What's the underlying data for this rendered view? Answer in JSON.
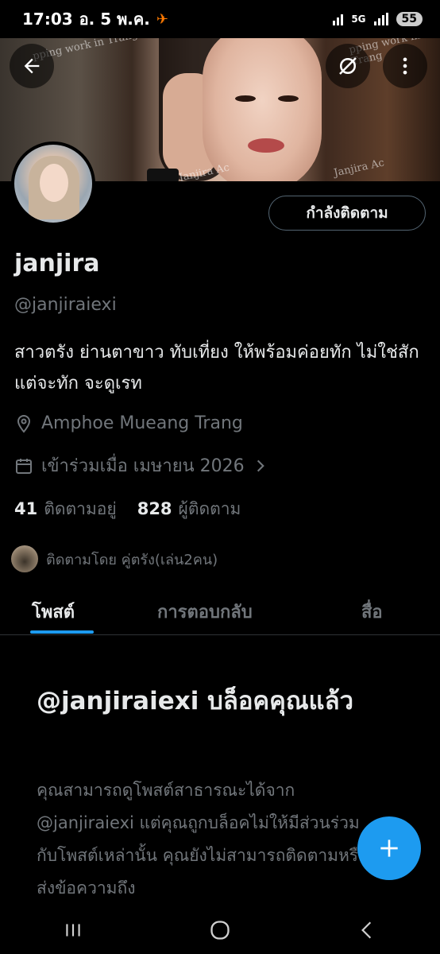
{
  "status_bar": {
    "time": "17:03",
    "date": "อ. 5 พ.ค.",
    "network": "5G",
    "battery": "55"
  },
  "banner": {
    "watermarks": [
      "pping work in Trang",
      "pping work in Trang",
      "Janjira Ac",
      "Janjira Ac"
    ]
  },
  "header_actions": {
    "back_icon": "arrow-left-icon",
    "hide_icon": "eye-off-icon",
    "more_icon": "more-vertical-icon"
  },
  "profile": {
    "follow_button": "กำลังติดตาม",
    "name": "janjira",
    "handle": "@janjiraiexi",
    "bio": "สาวตรัง ย่านตาขาว ทับเที่ยง  ให้พร้อมค่อยทัก ไม่ใช่สักแต่จะทัก จะดูเรท",
    "location": "Amphoe Mueang Trang",
    "joined": "เข้าร่วมเมื่อ เมษายน 2026",
    "following_count": "41",
    "following_label": "ติดตามอยู่",
    "followers_count": "828",
    "followers_label": "ผู้ติดตาม",
    "followed_by": "ติดตามโดย คู่ตรัง(เล่น2คน)"
  },
  "tabs": [
    "โพสต์",
    "การตอบกลับ",
    "สื่อ"
  ],
  "blocked": {
    "title": "@janjiraiexi บล็อคคุณแล้ว",
    "text": "คุณสามารถดูโพสต์สาธารณะได้จาก @janjiraiexi แต่คุณถูกบล็อคไม่ให้มีส่วนร่วมกับโพสต์เหล่านั้น คุณยังไม่สามารถติดตามหรือส่งข้อความถึง"
  },
  "colors": {
    "accent": "#1d9bf0",
    "background": "#000000",
    "primary_text": "#e7e9ea",
    "secondary_text": "#71767b"
  }
}
